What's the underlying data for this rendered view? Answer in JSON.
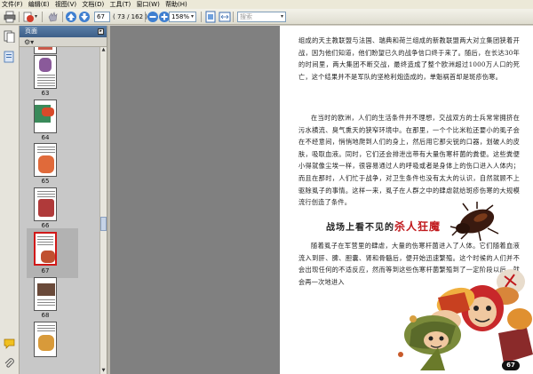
{
  "menu": {
    "items": [
      "文件(F)",
      "编辑(E)",
      "视图(V)",
      "文档(D)",
      "工具(T)",
      "窗口(W)",
      "帮助(H)"
    ]
  },
  "toolbar": {
    "current_page": "67",
    "page_total": "( 73 / 162 )",
    "zoom": "158%",
    "search_placeholder": "搜索"
  },
  "panel": {
    "title": "页面",
    "thumbnails": [
      {
        "page": "62"
      },
      {
        "page": "63"
      },
      {
        "page": "64"
      },
      {
        "page": "65"
      },
      {
        "page": "66"
      },
      {
        "page": "67",
        "selected": true
      },
      {
        "page": "68"
      }
    ]
  },
  "document": {
    "para1": "组成的天主教联盟与法国、瑞典和荷兰组成的新教联盟两大对立集团狭着开战，因为他们知道，他们盼望已久的战争信口终于来了。随后，在长达30年的时间里，两大集团不断交战，最终造成了整个欧洲超过1000万人口的死亡，这个结果并不是军队的坚枪利炮造成的，单魁祸首却是斑疹伤寒。",
    "para2": "在当时的欧洲，人们的生活条件并不理想，交战双方的士兵常常拥挤在污水横流、臭气熏天的狭窄环境中。在那里，一个个比米粒还要小的虱子会在不经意间，悄悄地爬到人们的身上，然后用它那尖锐的口器，划破人的皮肤，吸取血液。同时，它们还会排泄出带有大量伤寒杆菌的粪便。这些粪便小得就像尘埃一样，很容易通过人的呼吸或者是身体上的伤口进入人体内；而且在那时，人们忙于战争，对卫生条件也没有太大的认识，自然就顾不上驱除虱子的事情。这样一来，虱子在人群之中的肆虐就给斑疹伤寒的大规模流行创造了条件。",
    "heading_a": "战场上看不见的",
    "heading_b": "杀人狂魔",
    "para3a": "随着虱子在军营里的肆虐，大量的伤寒杆菌进入了人体。它们随着血液流入到肝、脾、胆囊、肾和骨髓后，便开始迅速繁殖。这个时候的人们并不会出现任何的不适反应，然而等到这些伤寒杆菌繁殖到了一定阶段以后，就会再一次地进入",
    "page_number": "67"
  },
  "colors": {
    "accent_red": "#c0181c",
    "panel_header": "#4a6c95",
    "doc_bg": "#808080"
  }
}
